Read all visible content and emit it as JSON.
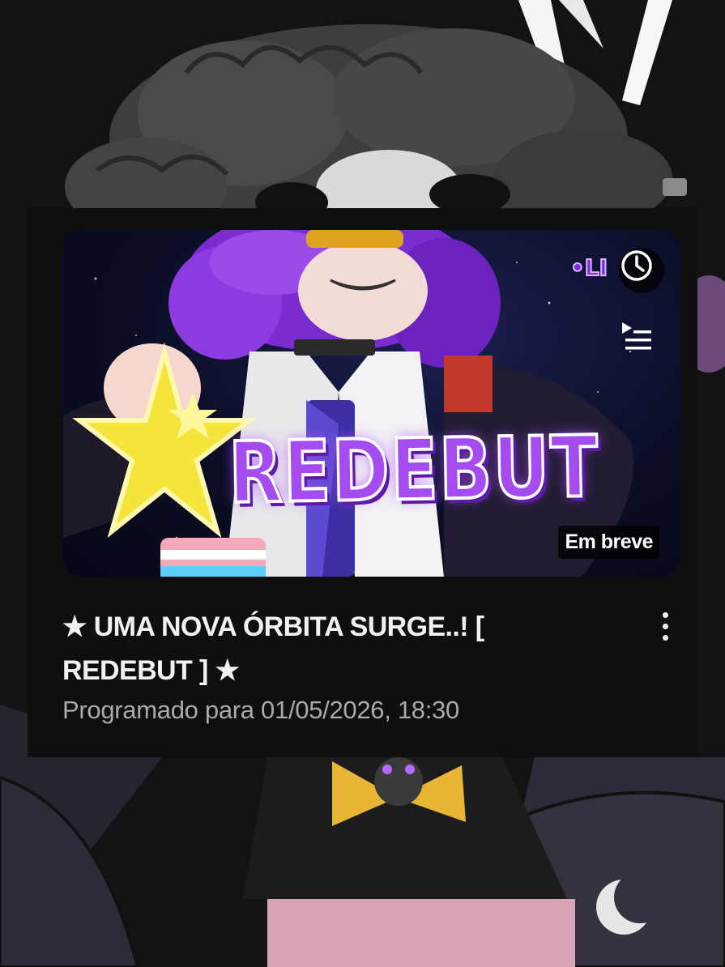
{
  "video": {
    "title": "★ UMA NOVA ÓRBITA SURGE..! [ REDEBUT ] ★",
    "meta": "Programado para 01/05/2026, 18:30",
    "status_badge": "Em breve",
    "thumbnail_text": "REDEBUT",
    "live_badge_text": "•LI"
  },
  "icons": {
    "clock": "clock-icon",
    "queue": "add-to-queue-icon",
    "more": "more-vert-icon"
  },
  "colors": {
    "card_bg": "#0f0f0f",
    "title_text": "#f1f1f1",
    "meta_text": "#aaaaaa",
    "thumbnail_accent": "#a54cf0"
  }
}
